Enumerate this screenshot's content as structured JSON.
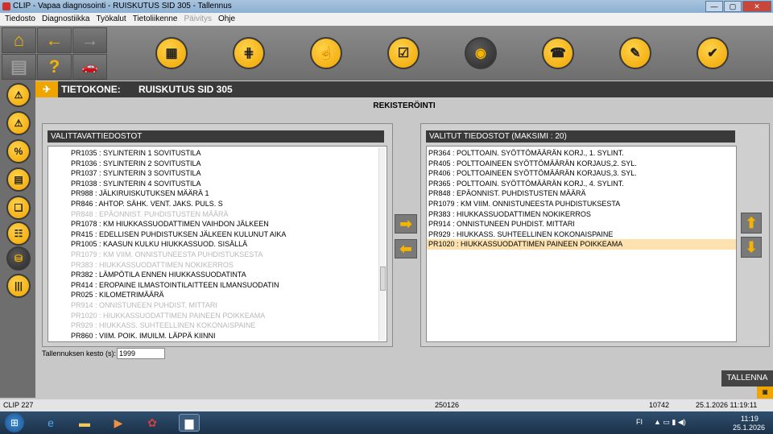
{
  "window": {
    "title": "CLIP - Vapaa diagnosointi - RUISKUTUS SID 305 - Tallennus",
    "minimize": "—",
    "maximize": "▢",
    "close": "✕"
  },
  "menu": [
    {
      "label": "Tiedosto",
      "disabled": false
    },
    {
      "label": "Diagnostiikka",
      "disabled": false
    },
    {
      "label": "Työkalut",
      "disabled": false
    },
    {
      "label": "Tietoliikenne",
      "disabled": false
    },
    {
      "label": "Päivitys",
      "disabled": true
    },
    {
      "label": "Ohje",
      "disabled": false
    }
  ],
  "nav": {
    "home": "⌂",
    "back": "←",
    "forward": "→",
    "print": "▤",
    "help": "?",
    "car": "🚗"
  },
  "toolbar_icons": [
    {
      "name": "vehicle-info-icon",
      "glyph": "▦",
      "active": false
    },
    {
      "name": "gearbox-icon",
      "glyph": "⋕",
      "active": false
    },
    {
      "name": "touch-icon",
      "glyph": "☝",
      "active": false
    },
    {
      "name": "checklist-icon",
      "glyph": "☑",
      "active": false
    },
    {
      "name": "diagnosis-icon",
      "glyph": "◉",
      "active": true
    },
    {
      "name": "phone-icon",
      "glyph": "☎",
      "active": false
    },
    {
      "name": "wrench-icon",
      "glyph": "✎",
      "active": false
    },
    {
      "name": "car-check-icon",
      "glyph": "✔",
      "active": false
    }
  ],
  "side_icons": [
    {
      "name": "warning-icon",
      "glyph": "⚠",
      "active": false
    },
    {
      "name": "warning-alt-icon",
      "glyph": "⚠",
      "active": false
    },
    {
      "name": "parameters-icon",
      "glyph": "%",
      "active": false
    },
    {
      "name": "status-icon",
      "glyph": "▤",
      "active": false
    },
    {
      "name": "book-icon",
      "glyph": "❏",
      "active": false
    },
    {
      "name": "tree-icon",
      "glyph": "☷",
      "active": false
    },
    {
      "name": "recording-icon",
      "glyph": "⛁",
      "active": true
    },
    {
      "name": "barcode-icon",
      "glyph": "|||",
      "active": false
    }
  ],
  "header": {
    "icon": "✈",
    "label": "TIETOKONE:",
    "value": "RUISKUTUS SID 305"
  },
  "section_title": "REKISTERÖINTI",
  "available": {
    "title": "VALITTAVATTIEDOSTOT",
    "items": [
      {
        "text": "PR1035 : SYLINTERIN 1 SOVITUSTILA",
        "disabled": false
      },
      {
        "text": "PR1036 : SYLINTERIN 2 SOVITUSTILA",
        "disabled": false
      },
      {
        "text": "PR1037 : SYLINTERIN 3 SOVITUSTILA",
        "disabled": false
      },
      {
        "text": "PR1038 : SYLINTERIN 4 SOVITUSTILA",
        "disabled": false
      },
      {
        "text": "PR988 : JÄLKIRUISKUTUKSEN MÄÄRÄ 1",
        "disabled": false
      },
      {
        "text": "PR846 : AHTOP. SÄHK. VENT. JAKS. PULS. S",
        "disabled": false
      },
      {
        "text": "PR848 : EPÄONNIST. PUHDISTUSTEN MÄÄRÄ",
        "disabled": true
      },
      {
        "text": "PR1078 : KM HIUKKASSUODATTIMEN VAIHDON JÄLKEEN",
        "disabled": false
      },
      {
        "text": "PR415 : EDELLISEN PUHDISTUKSEN JÄLKEEN KULUNUT AIKA",
        "disabled": false
      },
      {
        "text": "PR1005 : KAASUN KULKU HIUKKASSUOD. SISÄLLÄ",
        "disabled": false
      },
      {
        "text": "PR1079 : KM VIIM. ONNISTUNEESTA PUHDISTUKSESTA",
        "disabled": true
      },
      {
        "text": "PR383 : HIUKKASSUODATTIMEN NOKIKERROS",
        "disabled": true
      },
      {
        "text": "PR382 : LÄMPÖTILA ENNEN HIUKKASSUODATINTA",
        "disabled": false
      },
      {
        "text": "PR414 : EROPAINE ILMASTOINTILAITTEEN ILMANSUODATIN",
        "disabled": false
      },
      {
        "text": "PR025 : KILOMETRIMÄÄRÄ",
        "disabled": false
      },
      {
        "text": "PR914 : ONNISTUNEEN PUHDIST. MITTARI",
        "disabled": true
      },
      {
        "text": "PR1020 : HIUKKASSUODATTIMEN PAINEEN POIKKEAMA",
        "disabled": true
      },
      {
        "text": "PR929 : HIUKKASS. SUHTEELLINEN KOKONAISPAINE",
        "disabled": true
      },
      {
        "text": "PR860 : VIIM. POIK. IMUILM. LÄPPÄ KIINNI",
        "disabled": false
      }
    ]
  },
  "selected": {
    "title": "VALITUT TIEDOSTOT (MAKSIMI : 20)",
    "items": [
      {
        "text": "PR364 : POLTTOAIN. SYÖTTÖMÄÄRÄN KORJ., 1. SYLINT.",
        "selected": false
      },
      {
        "text": "PR405 : POLTTOAINEEN SYÖTTÖMÄÄRÄN KORJAUS,2. SYL.",
        "selected": false
      },
      {
        "text": "PR406 : POLTTOAINEEN SYÖTTÖMÄÄRÄN KORJAUS,3. SYL.",
        "selected": false
      },
      {
        "text": "PR365 : POLTTOAIN. SYÖTTÖMÄÄRÄN KORJ., 4. SYLINT.",
        "selected": false
      },
      {
        "text": "PR848 : EPÄONNIST. PUHDISTUSTEN MÄÄRÄ",
        "selected": false
      },
      {
        "text": "PR1079 : KM VIIM. ONNISTUNEESTA PUHDISTUKSESTA",
        "selected": false
      },
      {
        "text": "PR383 : HIUKKASSUODATTIMEN NOKIKERROS",
        "selected": false
      },
      {
        "text": "PR914 : ONNISTUNEEN PUHDIST. MITTARI",
        "selected": false
      },
      {
        "text": "PR929 : HIUKKASS. SUHTEELLINEN KOKONAISPAINE",
        "selected": false
      },
      {
        "text": "PR1020 : HIUKKASSUODATTIMEN PAINEEN POIKKEAMA",
        "selected": true
      }
    ]
  },
  "transfer": {
    "add": "➡",
    "remove": "⬅"
  },
  "order": {
    "up": "⬆",
    "down": "⬇"
  },
  "duration": {
    "label": "Tallennuksen kesto (s):",
    "value": "1999"
  },
  "save_label": "TALLENNA",
  "camera": "◙",
  "status": {
    "version": "CLIP 227",
    "code": "250126",
    "number": "10742",
    "datetime": "25.1.2026  11:19:11"
  },
  "taskbar": {
    "start": "⊞",
    "apps": [
      {
        "name": "ie-icon",
        "glyph": "e",
        "color": "#4aa8f0"
      },
      {
        "name": "folder-icon",
        "glyph": "▬",
        "color": "#f0c860"
      },
      {
        "name": "media-player-icon",
        "glyph": "▶",
        "color": "#f09040"
      },
      {
        "name": "diag-app-icon",
        "glyph": "✿",
        "color": "#d04040"
      },
      {
        "name": "clip-app-icon",
        "glyph": "▆",
        "color": "#ffffff"
      }
    ],
    "lang": "FI",
    "tray_icons": "▲ ▭ ▮ ◀)",
    "time": "11:19",
    "date": "25.1.2026"
  },
  "colors": {
    "accent": "#f0a400",
    "dark": "#3a3a3a",
    "selected_row": "#fde2b0"
  }
}
